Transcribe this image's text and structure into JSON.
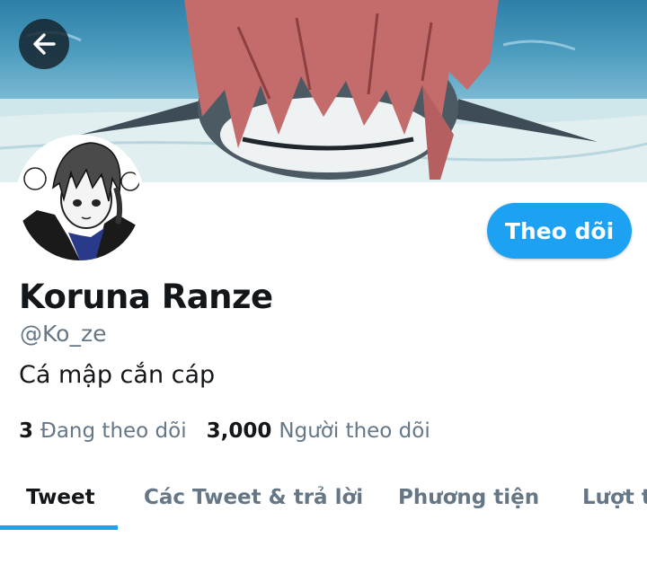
{
  "header": {
    "back_icon": "arrow-left-icon",
    "banner_description": "header-image"
  },
  "profile": {
    "display_name": "Koruna Ranze",
    "handle": "@Ko_ze",
    "bio": "Cá mập cắn cáp",
    "follow_label": "Theo dõi",
    "stats": [
      {
        "count": "3",
        "label": "Đang theo dõi"
      },
      {
        "count": "3,000",
        "label": "Người theo dõi"
      }
    ]
  },
  "tabs": [
    {
      "label": "Tweet",
      "active": true
    },
    {
      "label": "Các Tweet & trả lời",
      "active": false
    },
    {
      "label": "Phương tiện",
      "active": false
    },
    {
      "label": "Lượt t",
      "active": false
    }
  ],
  "colors": {
    "accent": "#1da1f2",
    "text_primary": "#14171a",
    "text_secondary": "#657786"
  }
}
